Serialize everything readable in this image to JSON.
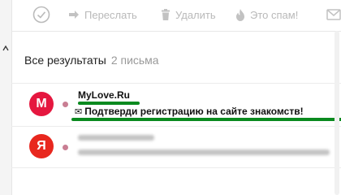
{
  "toolbar": {
    "forward_label": "Переслать",
    "delete_label": "Удалить",
    "spam_label": "Это спам!"
  },
  "results": {
    "title": "Все результаты",
    "count": "2 письма"
  },
  "messages": [
    {
      "avatar_letter": "M",
      "sender": "MyLove.Ru",
      "subject_icon": "envelope-icon",
      "subject": "Подтверди регистрацию на сайте знакомств!",
      "unread": true
    },
    {
      "avatar_letter": "Я",
      "sender_obscured": true,
      "subject_obscured": true,
      "unread": true
    }
  ],
  "colors": {
    "avatar_mylove": "#e5173f",
    "avatar_yandex": "#e8271e",
    "unread_dot": "#c97e93",
    "highlight": "#0a8a1f",
    "toolbar_disabled": "#b9b9b9"
  }
}
